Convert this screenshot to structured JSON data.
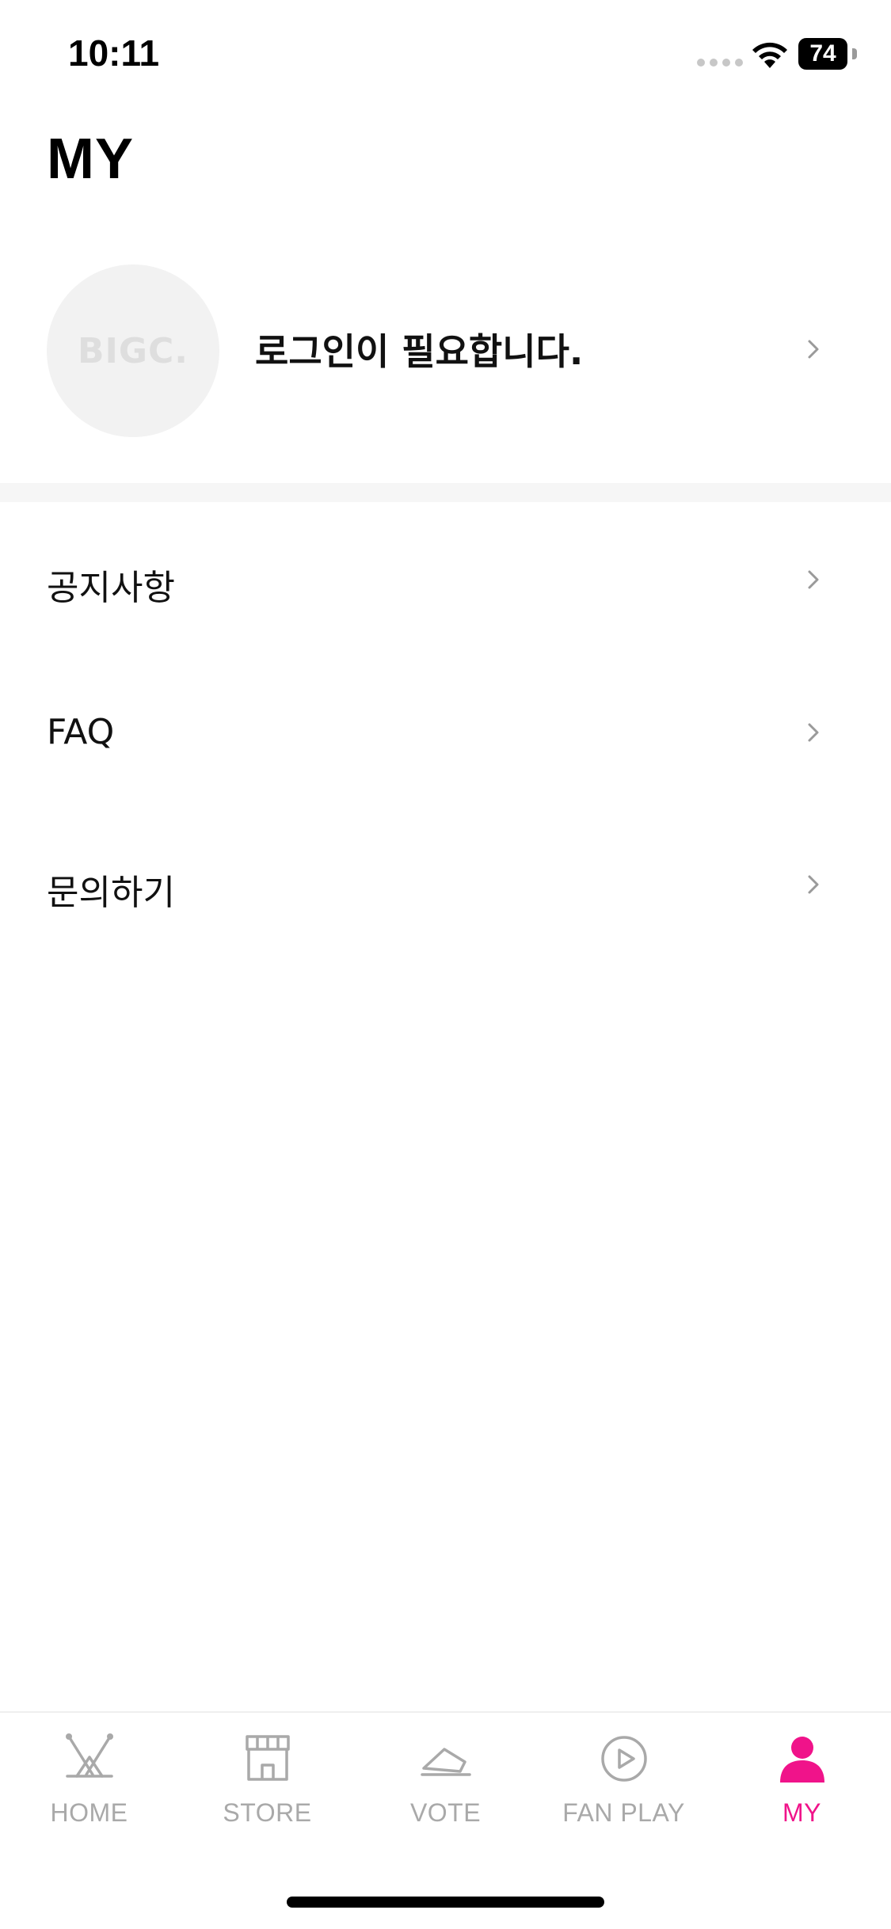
{
  "status_bar": {
    "time": "10:11",
    "battery": "74"
  },
  "header": {
    "title": "MY"
  },
  "profile": {
    "avatar_text": "BIGC.",
    "login_prompt": "로그인이 필요합니다."
  },
  "menu": {
    "items": [
      {
        "label": "공지사항"
      },
      {
        "label": "FAQ"
      },
      {
        "label": "문의하기"
      }
    ]
  },
  "tab_bar": {
    "active_color": "#f0138a",
    "inactive_color": "#a9a9a9",
    "tabs": [
      {
        "label": "HOME",
        "icon": "home-icon"
      },
      {
        "label": "STORE",
        "icon": "store-icon"
      },
      {
        "label": "VOTE",
        "icon": "vote-ticket-icon"
      },
      {
        "label": "FAN PLAY",
        "icon": "play-icon"
      },
      {
        "label": "MY",
        "icon": "person-icon",
        "active": true
      }
    ]
  }
}
